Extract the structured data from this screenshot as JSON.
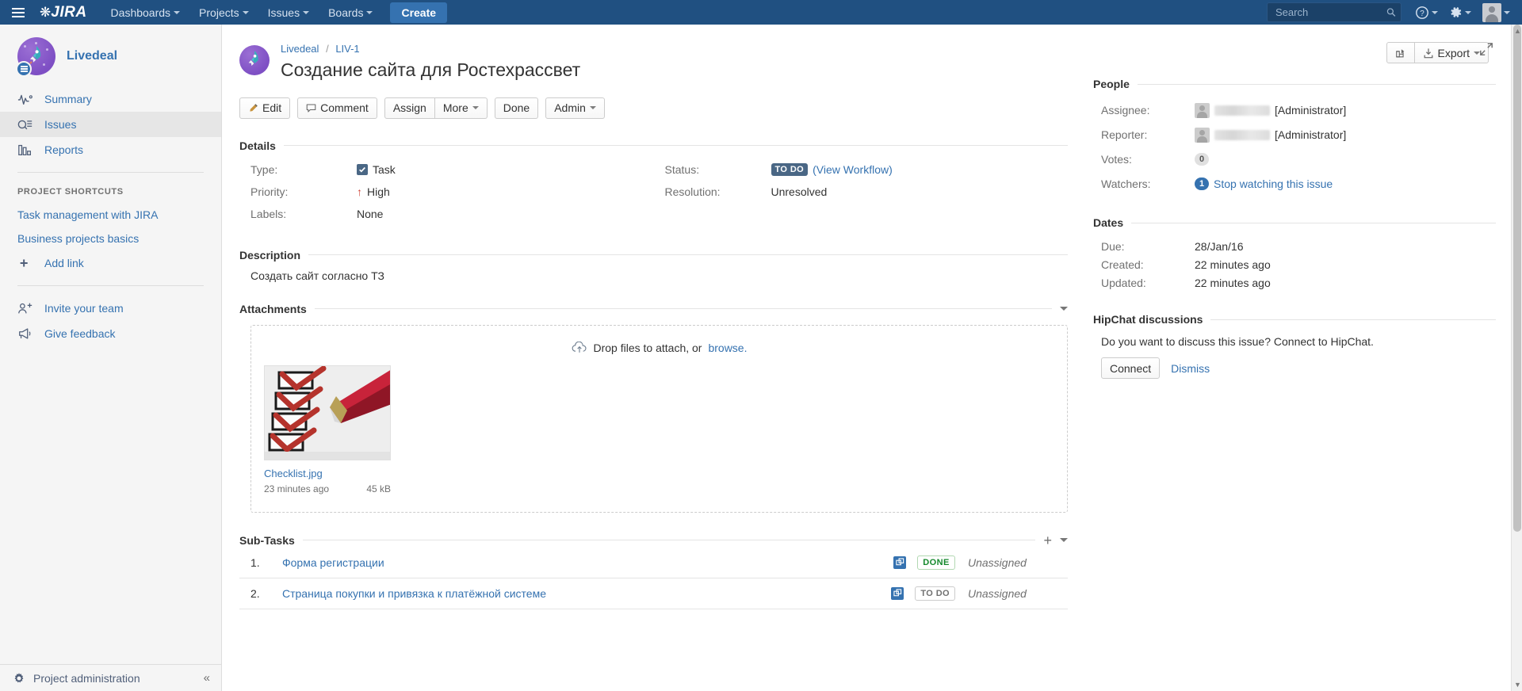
{
  "topnav": {
    "logo": "JIRA",
    "menu": [
      {
        "label": "Dashboards",
        "icon": "chevron-down-icon"
      },
      {
        "label": "Projects",
        "icon": "chevron-down-icon"
      },
      {
        "label": "Issues",
        "icon": "chevron-down-icon"
      },
      {
        "label": "Boards",
        "icon": "chevron-down-icon"
      }
    ],
    "create_label": "Create",
    "search_placeholder": "Search",
    "search_value": "",
    "icons": [
      "search-icon",
      "help-icon",
      "gear-icon",
      "avatar-icon"
    ],
    "brand_color": "#205081",
    "create_color": "#3572b0"
  },
  "sidebar": {
    "project_name": "Livedeal",
    "items": [
      {
        "label": "Summary",
        "icon": "summary-icon",
        "active": false
      },
      {
        "label": "Issues",
        "icon": "issues-icon",
        "active": true
      },
      {
        "label": "Reports",
        "icon": "reports-icon",
        "active": false
      }
    ],
    "shortcuts_heading": "PROJECT SHORTCUTS",
    "shortcuts": [
      {
        "label": "Task management with JIRA"
      },
      {
        "label": "Business projects basics"
      },
      {
        "label": "Add link",
        "icon": "plus-icon"
      }
    ],
    "bottom_links": [
      {
        "label": "Invite your team",
        "icon": "invite-user-icon"
      },
      {
        "label": "Give feedback",
        "icon": "megaphone-icon"
      }
    ],
    "footer": {
      "label": "Project administration",
      "icon": "gear-icon",
      "collapse": "«"
    }
  },
  "issue": {
    "breadcrumb": {
      "project": "Livedeal",
      "separator": "/",
      "key": "LIV-1"
    },
    "title": "Создание сайта для Ростехрассвет",
    "toolbar": {
      "edit": "Edit",
      "comment": "Comment",
      "assign": "Assign",
      "more": "More",
      "done": "Done",
      "admin": "Admin",
      "export": "Export",
      "share_icon": "share-icon",
      "collapse_icon": "collapse-icon"
    }
  },
  "details": {
    "title": "Details",
    "left": [
      {
        "label": "Type:",
        "value": "Task",
        "icon": "task-icon"
      },
      {
        "label": "Priority:",
        "value": "High",
        "icon": "priority-high-icon"
      },
      {
        "label": "Labels:",
        "value": "None",
        "icon": ""
      }
    ],
    "right": [
      {
        "label": "Status:",
        "value": "TO DO",
        "link": "(View Workflow)"
      },
      {
        "label": "Resolution:",
        "value": "Unresolved",
        "link": ""
      }
    ]
  },
  "description": {
    "title": "Description",
    "body": "Создать сайт согласно ТЗ"
  },
  "attachments": {
    "title": "Attachments",
    "dropzone_text": "Drop files to attach, or",
    "browse_label": "browse.",
    "items": [
      {
        "name": "Checklist.jpg",
        "age": "23 minutes ago",
        "size": "45 kB"
      }
    ]
  },
  "subtasks": {
    "title": "Sub-Tasks",
    "rows": [
      {
        "num": "1.",
        "name": "Форма регистрации",
        "status": "DONE",
        "assignee": "Unassigned"
      },
      {
        "num": "2.",
        "name": "Страница покупки и привязка к платёжной системе",
        "status": "TO DO",
        "assignee": "Unassigned"
      }
    ]
  },
  "people": {
    "title": "People",
    "assignee": {
      "label": "Assignee:",
      "value": "[Administrator]"
    },
    "reporter": {
      "label": "Reporter:",
      "value": "[Administrator]"
    },
    "votes": {
      "label": "Votes:",
      "count": "0"
    },
    "watchers": {
      "label": "Watchers:",
      "count": "1",
      "action": "Stop watching this issue"
    }
  },
  "dates": {
    "title": "Dates",
    "rows": [
      {
        "label": "Due:",
        "value": "28/Jan/16"
      },
      {
        "label": "Created:",
        "value": "22 minutes ago"
      },
      {
        "label": "Updated:",
        "value": "22 minutes ago"
      }
    ]
  },
  "hipchat": {
    "title": "HipChat discussions",
    "text": "Do you want to discuss this issue? Connect to HipChat.",
    "connect_label": "Connect",
    "dismiss_label": "Dismiss"
  }
}
